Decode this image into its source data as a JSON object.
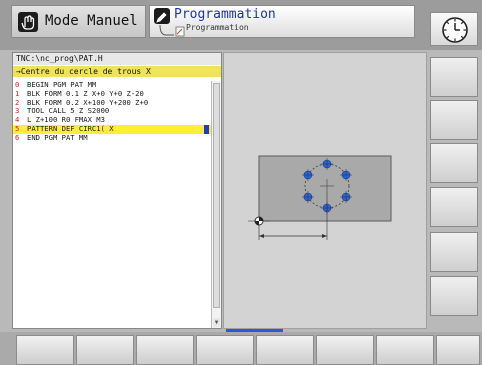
{
  "header": {
    "manual_tab_label": "Mode Manuel",
    "program_tab_label": "Programmation",
    "program_tab_sub": "Programmation"
  },
  "program": {
    "path": "TNC:\\nc_prog\\PAT.H",
    "cycle_prompt": "→Centre du cercle de trous X",
    "lines": [
      {
        "n": "0",
        "text": "BEGIN PGM PAT MM"
      },
      {
        "n": "1",
        "text": "BLK FORM 0.1 Z X+0 Y+0 Z-20"
      },
      {
        "n": "2",
        "text": "BLK FORM 0.2  X+100  Y+200  Z+0"
      },
      {
        "n": "3",
        "text": "TOOL CALL 5 Z S2000"
      },
      {
        "n": "4",
        "text": "L  Z+100 R0 FMAX M3"
      },
      {
        "n": "5",
        "text": "PATTERN DEF CIRC1( X"
      },
      {
        "n": "6",
        "text": "END PGM PAT MM"
      }
    ],
    "active_line": 5
  },
  "colors": {
    "accent": "#1f39d6",
    "highlight": "#ffef32",
    "prompt_bar": "#f1e25c",
    "line_numbers": "#d41f1f",
    "hole_blue": "#2b63d8"
  },
  "icons": {
    "manual_mode": "manual-mode-icon",
    "program_mode": "programming-mode-icon",
    "clock": "clock-icon",
    "datum": "datum-icon"
  }
}
